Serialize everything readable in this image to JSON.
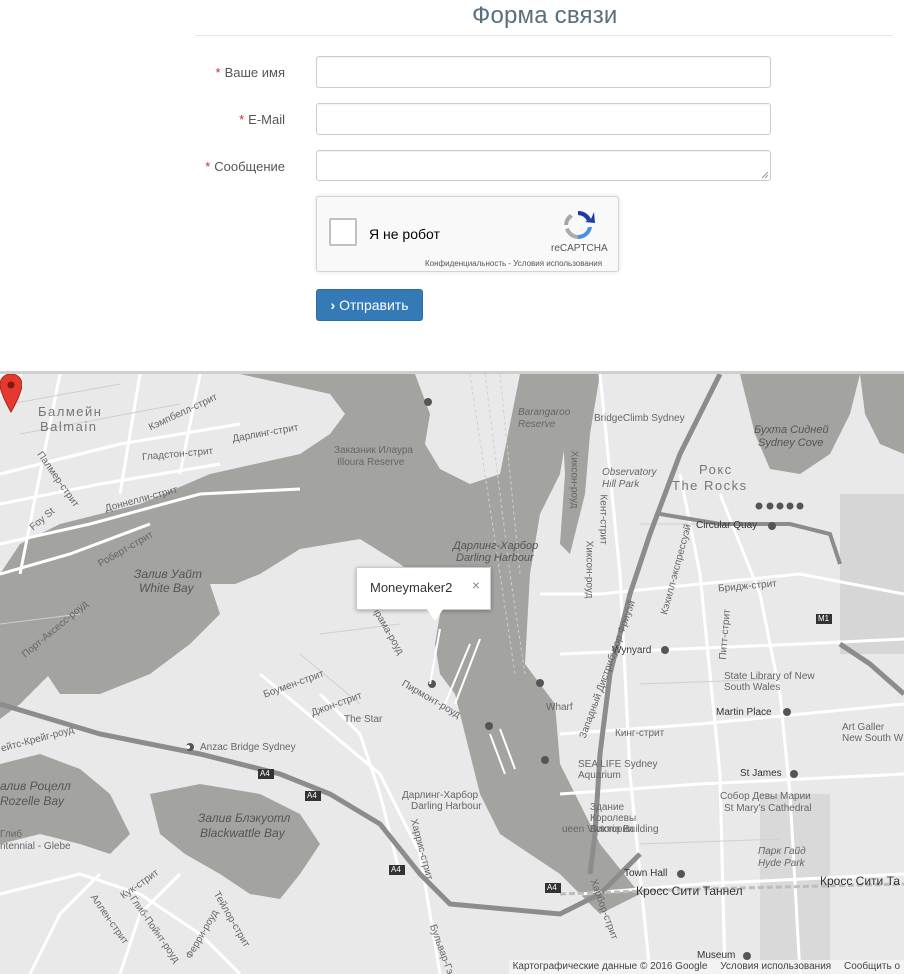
{
  "form": {
    "title": "Форма связи",
    "fields": [
      {
        "label": "Ваше имя",
        "required_mark": "*"
      },
      {
        "label": "E-Mail",
        "required_mark": "*"
      },
      {
        "label": "Сообщение",
        "required_mark": "*"
      }
    ],
    "captcha": {
      "label": "Я не робот",
      "brand": "reCAPTCHA",
      "links": "Конфиденциальность - Условия использования"
    },
    "submit_label": "Отправить",
    "submit_icon": "chevron-right-icon"
  },
  "map": {
    "infowindow_text": "Moneymaker2",
    "close_glyph": "×",
    "labels": {
      "balmain_ru": "Балмейн",
      "balmain_en": "Balmain",
      "rocks_ru": "Рокс",
      "rocks_en": "The Rocks",
      "white_bay_ru": "Залив Уайт",
      "white_bay_en": "White Bay",
      "darling_ru": "Дарлинг-Харбор",
      "darling_en": "Darling Harbour",
      "blackwattle_ru": "Залив Блэкуотл",
      "blackwattle_en": "Blackwattle Bay",
      "rozelle_ru": "алив Роцелл",
      "rozelle_en": "Rozelle Bay",
      "sydney_cove_ru": "Бухта Сидней",
      "sydney_cove_en": "Sydney Cove",
      "illoura_ru": "Заказник Илаура",
      "illoura_en": "Illoura Reserve",
      "barangaroo": "Barangaroo Reserve",
      "bridgeclimb": "BridgeClimb Sydney",
      "observatory": "Observatory Hill Park",
      "circular_quay": "Circular Quay",
      "wynyard": "Wynyard",
      "martin_place": "Martin Place",
      "st_james": "St James",
      "town_hall": "Town Hall",
      "museum": "Museum",
      "state_library": "State Library of New South Wales",
      "art_gallery": "Art Galler New South W",
      "st_marys_ru": "Собор Девы Марии",
      "st_marys_en": "St Mary's Cathedral",
      "hyde_park_ru": "Парк Гайд",
      "hyde_park_en": "Hyde Park",
      "sea_life": "SEA LIFE Sydney Aquarium",
      "qvb_ru": "Здание Королевы Виктории",
      "qvb_en": "ueen Victoria Building",
      "the_star": "The Star",
      "anzac_bridge": "Anzac Bridge Sydney",
      "wharf": "Wharf",
      "darling_st": "Дарлинг-стрит",
      "gladstone_st": "Гладстон-стрит",
      "campbell_st": "Кэмпбелл-стрит",
      "palmer_st": "Палмер-стрит",
      "donnelly_st": "Доннелли-стрит",
      "robert_st": "Роберт-стрит",
      "port_access": "Порт-Аксесс-роуд",
      "james_craig": "ейтс-Крейг-роуд",
      "bowman_st": "Боумен-стрит",
      "john_st": "Джон-стрит",
      "pyrmont_rd": "Пирмонт-роуд",
      "pyramid_rd": "Пирама-роуд",
      "harris_st": "Харрис-стрит",
      "hickson_rd": "Хиксон-роуд",
      "kent_st": "Кент-стрит",
      "king_st": "Кинг-стрит",
      "bridge_st": "Бридж-стрит",
      "pitt_st": "Питт-стрит",
      "cahill": "Кэхилл-экспрессуэй",
      "distributor": "Западный Дистрибутор Фриуэй",
      "cross_city": "Кросс Сити Таннел",
      "cross_city2": "Кросс Сити Та",
      "cook_st": "Кук-стрит",
      "allen_st": "Аллен-стрит",
      "glebe_st": "Глиб-Пойнт-роуд",
      "ferry_rd": "Ферри-роуд",
      "taylor_st": "Тейлор-стрит",
      "harbour_st": "Харбор-стрит",
      "boulevard": "Бульвар-Гэ",
      "glebe": "Глиб",
      "glebe2": "ntennial - Glebe",
      "foy": "Foy St",
      "a4_1": "A4",
      "a4_2": "A4",
      "a4_3": "A4",
      "a4_4": "A4",
      "m1": "M1"
    },
    "attribution": {
      "data": "Картографические данные © 2016 Google",
      "terms": "Условия использования",
      "report": "Сообщить о"
    }
  },
  "colors": {
    "accent": "#337ab7",
    "required": "#c9302c",
    "water": "#a3a3a0",
    "land": "#e9e9e9",
    "road": "#ffffff",
    "pin": "#e5382f"
  }
}
